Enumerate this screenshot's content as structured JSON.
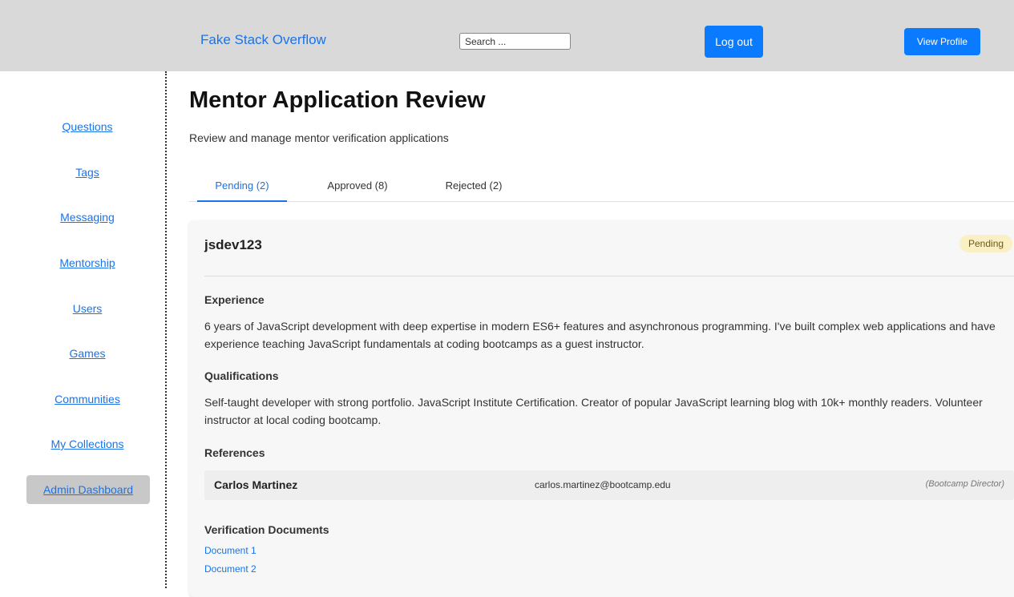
{
  "header": {
    "brand": "Fake Stack Overflow",
    "search_placeholder": "Search ...",
    "logout_label": "Log out",
    "view_profile_label": "View Profile"
  },
  "sidebar": {
    "items": [
      {
        "label": "Questions"
      },
      {
        "label": "Tags"
      },
      {
        "label": "Messaging"
      },
      {
        "label": "Mentorship"
      },
      {
        "label": "Users"
      },
      {
        "label": "Games"
      },
      {
        "label": "Communities"
      },
      {
        "label": "My Collections"
      },
      {
        "label": "Admin Dashboard",
        "active": true
      }
    ]
  },
  "main": {
    "title": "Mentor Application Review",
    "subtitle": "Review and manage mentor verification applications",
    "tabs": [
      {
        "label": "Pending (2)",
        "active": true
      },
      {
        "label": "Approved (8)"
      },
      {
        "label": "Rejected (2)"
      }
    ],
    "application": {
      "username": "jsdev123",
      "status": "Pending",
      "experience_heading": "Experience",
      "experience_text": "6 years of JavaScript development with deep expertise in modern ES6+ features and asynchronous programming. I've built complex web applications and have experience teaching JavaScript fundamentals at coding bootcamps as a guest instructor.",
      "qualifications_heading": "Qualifications",
      "qualifications_text": "Self-taught developer with strong portfolio. JavaScript Institute Certification. Creator of popular JavaScript learning blog with 10k+ monthly readers. Volunteer instructor at local coding bootcamp.",
      "references_heading": "References",
      "references": [
        {
          "name": "Carlos Martinez",
          "email": "carlos.martinez@bootcamp.edu",
          "role": "(Bootcamp Director)"
        }
      ],
      "documents_heading": "Verification Documents",
      "documents": [
        "Document 1",
        "Document 2"
      ]
    }
  },
  "colors": {
    "accent": "#1a73e8",
    "button": "#0a7aff",
    "header_bg": "#d9d9d9",
    "badge_bg": "#fbefc4"
  }
}
